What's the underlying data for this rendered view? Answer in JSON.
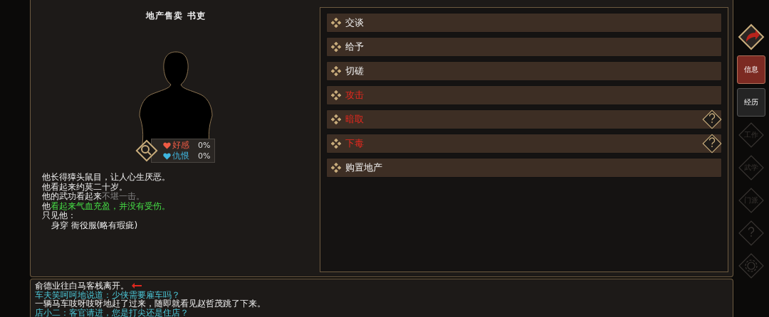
{
  "character": {
    "title": "地产售卖 书吏",
    "relations": [
      {
        "kind": "favor",
        "label": "好感",
        "value": "0%"
      },
      {
        "kind": "hatred",
        "label": "仇恨",
        "value": "0%"
      }
    ],
    "description": [
      [
        {
          "kind": "normal",
          "text": "他长得獐头鼠目，让人心生厌恶。"
        }
      ],
      [
        {
          "kind": "normal",
          "text": "他看起来约莫二十岁。"
        }
      ],
      [
        {
          "kind": "normal",
          "text": "他的武功看起来"
        },
        {
          "kind": "dim",
          "text": "不堪一击。"
        }
      ],
      [
        {
          "kind": "normal",
          "text": "他"
        },
        {
          "kind": "good",
          "text": "看起来气血充盈，并没有受伤。"
        }
      ],
      [
        {
          "kind": "normal",
          "text": "只见他："
        }
      ],
      [
        {
          "kind": "indent",
          "text": "身穿  衙役服(略有瑕疵)"
        }
      ]
    ]
  },
  "actions": [
    {
      "label": "交谈",
      "danger": false,
      "help": false
    },
    {
      "label": "给予",
      "danger": false,
      "help": false
    },
    {
      "label": "切磋",
      "danger": false,
      "help": false
    },
    {
      "label": "攻击",
      "danger": true,
      "help": false
    },
    {
      "label": "暗取",
      "danger": true,
      "help": true
    },
    {
      "label": "下毒",
      "danger": true,
      "help": true
    },
    {
      "label": "购置地产",
      "danger": false,
      "help": false
    }
  ],
  "side_tabs": [
    {
      "kind": "text",
      "label": "信息",
      "selected": true,
      "disabled": false
    },
    {
      "kind": "text",
      "label": "经历",
      "selected": false,
      "disabled": false
    },
    {
      "kind": "diamond",
      "label": "工作",
      "selected": false,
      "disabled": true
    },
    {
      "kind": "diamond",
      "label": "武学",
      "selected": false,
      "disabled": true
    },
    {
      "kind": "diamond",
      "label": "门派",
      "selected": false,
      "disabled": true
    },
    {
      "kind": "help",
      "selected": false,
      "disabled": true
    },
    {
      "kind": "gear",
      "selected": false,
      "disabled": true
    }
  ],
  "log": [
    {
      "kind": "latest",
      "text": "俞德业往白马客栈离开。"
    },
    {
      "kind": "speech",
      "text": "车夫笑呵呵地说道：少侠需要雇车吗？"
    },
    {
      "kind": "event",
      "text": "一辆马车吱呀吱呀地赶了过来，随即就看见赵哲茂跳了下来。"
    },
    {
      "kind": "speech",
      "text": "店小二：客官请进，您是打尖还是住店？"
    }
  ]
}
